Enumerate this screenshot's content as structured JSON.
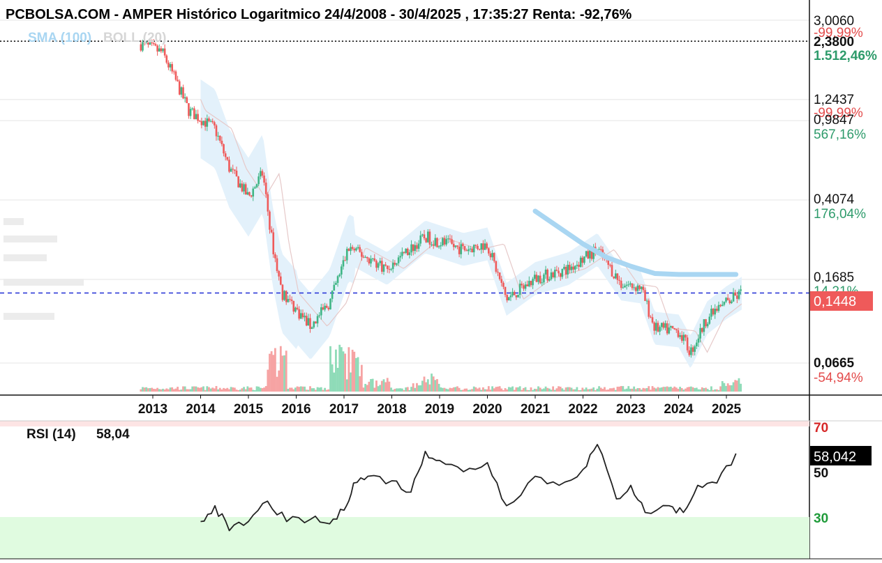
{
  "header": {
    "title": "PCBOLSA.COM - AMPER Histórico Logaritmico 24/4/2008 - 30/4/2025 , 17:35:27 Renta: -92,76%",
    "legend_sma": "SMA (100)",
    "legend_boll": "BOLL (20)"
  },
  "price_axis": {
    "ticks": [
      "3,0060",
      "2,3800",
      "1,2437",
      "0,9847",
      "0,4074",
      "0,1685",
      "0,0665"
    ],
    "percents": [
      "-99,99%",
      "1.512,46%",
      "-99,99%",
      "567,16%",
      "176,04%",
      "14,21%",
      "-54,94%"
    ],
    "current_price_tag": "0,1448"
  },
  "rsi_panel": {
    "label": "RSI (14)",
    "value": "58,04",
    "value_tag": "58,042",
    "level_70": "70",
    "level_50": "50",
    "level_30": "30"
  },
  "colors": {
    "up": "#3fb585",
    "down": "#ef5a5a",
    "band_fill": "#e3f1fb",
    "sma": "#a9d6f2",
    "boll_mid": "#e6c9c9",
    "current_line": "#1f2bd6",
    "tag_bg": "#ef5a5a",
    "rsi_line": "#222222",
    "rsi_oversold_fill": "#e0fbe0"
  },
  "chart_data": [
    {
      "type": "candlestick",
      "title": "PCBOLSA.COM - AMPER Histórico Logaritmico 24/4/2008 - 30/4/2025 , 17:35:27 Renta: -92,76%",
      "scale": "log",
      "ylim": [
        0.05,
        3.006
      ],
      "y_ticks": [
        3.006,
        2.38,
        1.2437,
        0.9847,
        0.4074,
        0.1685,
        0.0665
      ],
      "x_tick_labels": [
        "2013",
        "2014",
        "2015",
        "2016",
        "2017",
        "2018",
        "2019",
        "2020",
        "2021",
        "2022",
        "2023",
        "2024",
        "2025"
      ],
      "current_price": 0.1448,
      "reference_high": 2.38,
      "price_path": [
        {
          "t": 2012.75,
          "v": 2.3
        },
        {
          "t": 2013.2,
          "v": 2.1
        },
        {
          "t": 2013.5,
          "v": 1.5
        },
        {
          "t": 2013.75,
          "v": 1.1
        },
        {
          "t": 2014.3,
          "v": 0.9
        },
        {
          "t": 2014.6,
          "v": 0.58
        },
        {
          "t": 2015.0,
          "v": 0.42
        },
        {
          "t": 2015.3,
          "v": 0.55
        },
        {
          "t": 2015.5,
          "v": 0.25
        },
        {
          "t": 2015.7,
          "v": 0.145
        },
        {
          "t": 2016.3,
          "v": 0.1
        },
        {
          "t": 2016.7,
          "v": 0.13
        },
        {
          "t": 2017.1,
          "v": 0.24
        },
        {
          "t": 2017.9,
          "v": 0.19
        },
        {
          "t": 2018.7,
          "v": 0.27
        },
        {
          "t": 2019.5,
          "v": 0.235
        },
        {
          "t": 2020.0,
          "v": 0.25
        },
        {
          "t": 2020.4,
          "v": 0.135
        },
        {
          "t": 2021.0,
          "v": 0.17
        },
        {
          "t": 2021.7,
          "v": 0.19
        },
        {
          "t": 2022.3,
          "v": 0.235
        },
        {
          "t": 2022.8,
          "v": 0.16
        },
        {
          "t": 2023.2,
          "v": 0.155
        },
        {
          "t": 2023.5,
          "v": 0.098
        },
        {
          "t": 2024.0,
          "v": 0.095
        },
        {
          "t": 2024.25,
          "v": 0.075
        },
        {
          "t": 2024.6,
          "v": 0.11
        },
        {
          "t": 2025.0,
          "v": 0.13
        },
        {
          "t": 2025.33,
          "v": 0.145
        }
      ],
      "sma_100": [
        {
          "t": 2021.0,
          "v": 0.36
        },
        {
          "t": 2021.5,
          "v": 0.3
        },
        {
          "t": 2022.0,
          "v": 0.25
        },
        {
          "t": 2022.5,
          "v": 0.215
        },
        {
          "t": 2023.0,
          "v": 0.195
        },
        {
          "t": 2023.5,
          "v": 0.18
        },
        {
          "t": 2024.0,
          "v": 0.178
        },
        {
          "t": 2025.2,
          "v": 0.178
        }
      ]
    },
    {
      "type": "line",
      "title": "RSI (14)",
      "ylim": [
        0,
        100
      ],
      "levels": [
        70,
        50,
        30
      ],
      "series": [
        {
          "name": "RSI (14)",
          "points": [
            {
              "t": 2014.0,
              "v": 28
            },
            {
              "t": 2014.3,
              "v": 35
            },
            {
              "t": 2014.6,
              "v": 24
            },
            {
              "t": 2015.0,
              "v": 28
            },
            {
              "t": 2015.4,
              "v": 37
            },
            {
              "t": 2015.8,
              "v": 28
            },
            {
              "t": 2016.3,
              "v": 29
            },
            {
              "t": 2016.7,
              "v": 27
            },
            {
              "t": 2017.0,
              "v": 33
            },
            {
              "t": 2017.2,
              "v": 45
            },
            {
              "t": 2017.5,
              "v": 48
            },
            {
              "t": 2018.0,
              "v": 46
            },
            {
              "t": 2018.4,
              "v": 41
            },
            {
              "t": 2018.7,
              "v": 59
            },
            {
              "t": 2019.0,
              "v": 55
            },
            {
              "t": 2019.5,
              "v": 50
            },
            {
              "t": 2020.0,
              "v": 54
            },
            {
              "t": 2020.4,
              "v": 35
            },
            {
              "t": 2021.0,
              "v": 48
            },
            {
              "t": 2021.5,
              "v": 44
            },
            {
              "t": 2022.0,
              "v": 51
            },
            {
              "t": 2022.3,
              "v": 62
            },
            {
              "t": 2022.7,
              "v": 38
            },
            {
              "t": 2023.0,
              "v": 44
            },
            {
              "t": 2023.3,
              "v": 32
            },
            {
              "t": 2023.8,
              "v": 35
            },
            {
              "t": 2024.1,
              "v": 32
            },
            {
              "t": 2024.4,
              "v": 44
            },
            {
              "t": 2024.8,
              "v": 45
            },
            {
              "t": 2025.2,
              "v": 58.04
            }
          ]
        }
      ]
    }
  ]
}
